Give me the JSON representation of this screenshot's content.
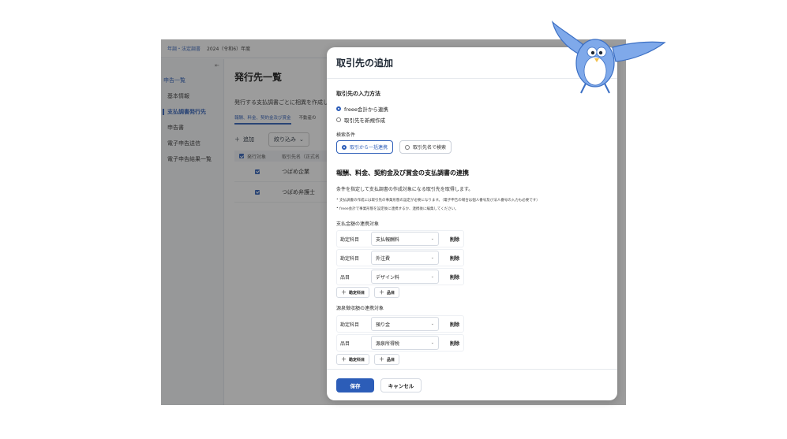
{
  "app": {
    "topbar": {
      "breadcrumb": "年調・法定調書",
      "year": "2024（令和6）年度"
    },
    "sidebar": {
      "group": "申告一覧",
      "items": [
        "基本情報",
        "支払調書発行先",
        "申告書",
        "電子申告送信",
        "電子申告結果一覧"
      ],
      "active_index": 1
    },
    "main": {
      "title": "発行先一覧",
      "description": "発行する支払調書ごとに相異を作成し",
      "tabs": [
        "報酬、料金、契約金及び賞金",
        "不動産の"
      ],
      "add_label": "追加",
      "filter_label": "絞り込み",
      "table": {
        "headers": [
          "発行対象",
          "取引先名（正式名"
        ],
        "rows": [
          {
            "name": "つばめ企業"
          },
          {
            "name": "つばめ弁護士"
          }
        ]
      }
    }
  },
  "modal": {
    "title": "取引先の追加",
    "input_method": {
      "title": "取引先の入力方法",
      "options": [
        "freee会計から連携",
        "取引先を新規作成"
      ],
      "selected_index": 0
    },
    "search": {
      "label": "検索条件",
      "options": [
        "取引から一括連携",
        "取引先名で検索"
      ],
      "selected_index": 0
    },
    "section": {
      "title": "報酬、料金、契約金及び賞金の支払調書の連携",
      "description": "条件を指定して支払調書の作成対象になる取引先を取得します。",
      "bullets": [
        "支払調書の作成には取引先の事業形態の設定が必要になります。（電子申告の場合は個人番号及び法人番号の入力も必要です）",
        "freee会計で事業形態を設定後に連携するか、連携後に編集してください。"
      ]
    },
    "payment_target": {
      "title": "支払金額の連携対象",
      "rows": [
        {
          "label": "勘定科目",
          "value": "支払報酬料"
        },
        {
          "label": "勘定科目",
          "value": "外注費"
        },
        {
          "label": "品目",
          "value": "デザイン料"
        }
      ],
      "delete_label": "削除",
      "add_account_label": "勘定科目",
      "add_item_label": "品目"
    },
    "withholding_target": {
      "title": "源泉徴収額の連携対象",
      "rows": [
        {
          "label": "勘定科目",
          "value": "預り金"
        },
        {
          "label": "品目",
          "value": "源泉所得税"
        }
      ],
      "delete_label": "削除",
      "add_account_label": "勘定科目",
      "add_item_label": "品目"
    },
    "footer": {
      "save_label": "保存",
      "cancel_label": "キャンセル"
    }
  },
  "colors": {
    "primary": "#2c5db8",
    "overlay": "rgba(40,40,40,0.46)",
    "mascot_blue": "#7fa9ea"
  },
  "icons": {
    "plus": "plus-icon",
    "chevron": "chevron-down-icon",
    "collapse": "sidebar-collapse-icon",
    "mascot": "swallow-mascot"
  }
}
